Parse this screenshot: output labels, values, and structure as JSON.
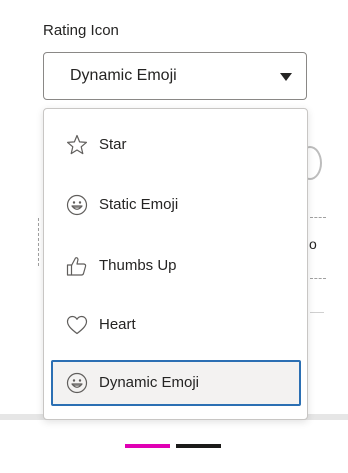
{
  "field": {
    "label": "Rating Icon",
    "selected_value": "Dynamic Emoji"
  },
  "background": {
    "partial_text": "o"
  },
  "dropdown": {
    "options": [
      {
        "label": "Star",
        "icon": "star-icon"
      },
      {
        "label": "Static Emoji",
        "icon": "smiley-icon"
      },
      {
        "label": "Thumbs Up",
        "icon": "thumbs-up-icon"
      },
      {
        "label": "Heart",
        "icon": "heart-icon"
      },
      {
        "label": "Dynamic Emoji",
        "icon": "smiley-icon",
        "selected": true
      }
    ]
  },
  "colors": {
    "selection_border": "#2b6fb3",
    "indicator_pink": "#e000b4",
    "indicator_dark": "#1b1a19"
  }
}
